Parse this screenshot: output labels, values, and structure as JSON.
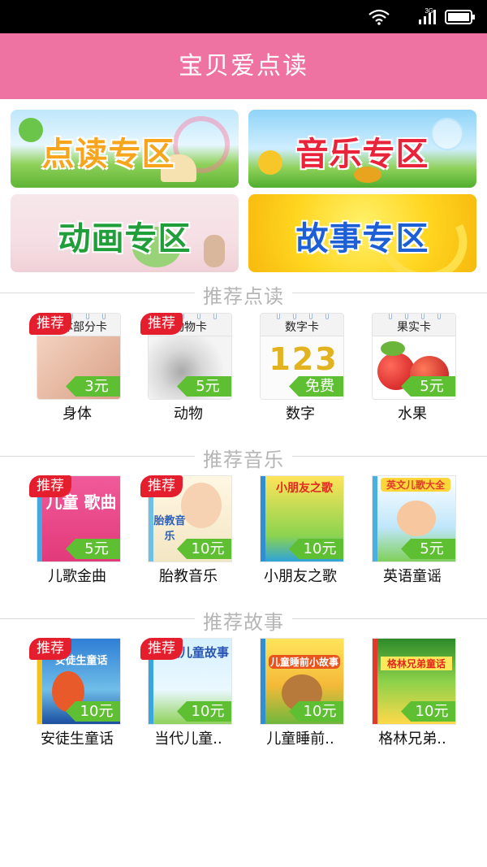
{
  "status_bar": {
    "network": "3G",
    "icons": [
      "wifi-icon",
      "signal-icon",
      "battery-icon"
    ]
  },
  "header": {
    "title": "宝贝爱点读"
  },
  "zones": [
    {
      "label": "点读专区"
    },
    {
      "label": "音乐专区"
    },
    {
      "label": "动画专区"
    },
    {
      "label": "故事专区"
    }
  ],
  "sections": [
    {
      "title": "推荐点读",
      "items": [
        {
          "cover_text": "身体部分卡",
          "price": "3元",
          "label": "身体",
          "badge": "推荐"
        },
        {
          "cover_text": "动物卡",
          "price": "5元",
          "label": "动物",
          "badge": "推荐"
        },
        {
          "cover_text": "数字卡",
          "cover_big": "123",
          "price": "免费",
          "label": "数字",
          "badge": ""
        },
        {
          "cover_text": "果实卡",
          "price": "5元",
          "label": "水果",
          "badge": ""
        }
      ]
    },
    {
      "title": "推荐音乐",
      "items": [
        {
          "cover_text": "儿童 歌曲",
          "price": "5元",
          "label": "儿歌金曲",
          "badge": "推荐"
        },
        {
          "cover_text": "胎教音乐",
          "price": "10元",
          "label": "胎教音乐",
          "badge": "推荐"
        },
        {
          "cover_text": "小朋友之歌",
          "price": "10元",
          "label": "小朋友之歌",
          "badge": ""
        },
        {
          "cover_text": "英文儿歌大全",
          "price": "5元",
          "label": "英语童谣",
          "badge": ""
        }
      ]
    },
    {
      "title": "推荐故事",
      "items": [
        {
          "cover_text": "安徒生童话",
          "price": "10元",
          "label": "安徒生童话",
          "badge": "推荐"
        },
        {
          "cover_text": "当代儿童故事",
          "price": "10元",
          "label": "当代儿童..",
          "badge": "推荐"
        },
        {
          "cover_text": "儿童睡前小故事",
          "price": "10元",
          "label": "儿童睡前..",
          "badge": ""
        },
        {
          "cover_text": "格林兄弟童话",
          "price": "10元",
          "label": "格林兄弟..",
          "badge": ""
        }
      ]
    }
  ],
  "colors": {
    "header": "#ee72a2",
    "badge": "#e51e2e",
    "price_tag": "#5fbf32",
    "section_title": "#b5b5b5"
  }
}
